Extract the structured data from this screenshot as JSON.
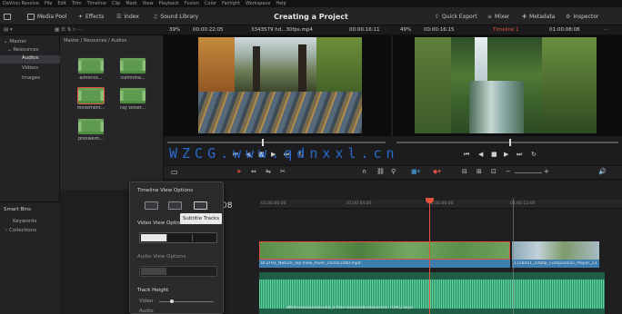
{
  "menu": {
    "items": [
      "DaVinci Resolve",
      "File",
      "Edit",
      "Trim",
      "Timeline",
      "Clip",
      "Mark",
      "View",
      "Playback",
      "Fusion",
      "Color",
      "Fairlight",
      "Workspace",
      "Help"
    ]
  },
  "toolbar": {
    "media_pool": "Media Pool",
    "effects": "Effects",
    "index": "Index",
    "sound_library": "Sound Library",
    "project_title": "Creating a Project",
    "quick_export": "Quick Export",
    "mixer": "Mixer",
    "metadata": "Metadata",
    "inspector": "Inspector"
  },
  "viewer_bar": {
    "zoom_left": "39%",
    "timecode_left_dur": "00:00:22:05",
    "clip_name": "3343579 hd...30fps.mp4",
    "timecode_left": "00:00:16:11",
    "zoom_right": "49%",
    "timecode_right_dur": "00:00:16:15",
    "timeline_name": "Timeline 1",
    "timecode_right": "01:00:08:08"
  },
  "bins": {
    "master": "Master",
    "resources": "Resources",
    "audios": "Audios",
    "videos": "Videos",
    "images": "Images"
  },
  "pool": {
    "breadcrumb": "Master / Resources / Audios",
    "clips": [
      {
        "label": "aimerick..."
      },
      {
        "label": "clemtoha..."
      },
      {
        "label": "movement..."
      },
      {
        "label": "ray sinker..."
      },
      {
        "label": "preswelm..."
      }
    ]
  },
  "smart_bins": {
    "title": "Smart Bins",
    "keywords": "Keywords",
    "collections": "Collections"
  },
  "popup": {
    "timeline_view_options": "Timeline View Options",
    "video_view_options": "Video View Options",
    "audio_view_options": "Audio View Options",
    "track_height": "Track Height",
    "video": "Video",
    "audio": "Audio"
  },
  "tooltip": "Subtitle Tracks",
  "timeline": {
    "timecode_partial": "08",
    "ruler": [
      "01:00:00:00",
      "01:00:04:00",
      "01:00:08:00",
      "01:00:12:00"
    ],
    "clip1": "BF2F91_Nature_Top View_River_1920x1080.mp4",
    "clip2": "1158451_1080p_Composition_Player_13...",
    "audio_clip": "athenaxxsoundsound_a-free-headshot-sound-mix-70902.mp4"
  },
  "watermark": "WZCG.www.qdnxxl.cn",
  "colors": {
    "accent_red": "#e0533c",
    "clip_green": "#6fa25c",
    "audio_green": "#1f5e45",
    "clip_blue": "#3f7fb0",
    "watermark_blue": "#2a6fd6"
  }
}
